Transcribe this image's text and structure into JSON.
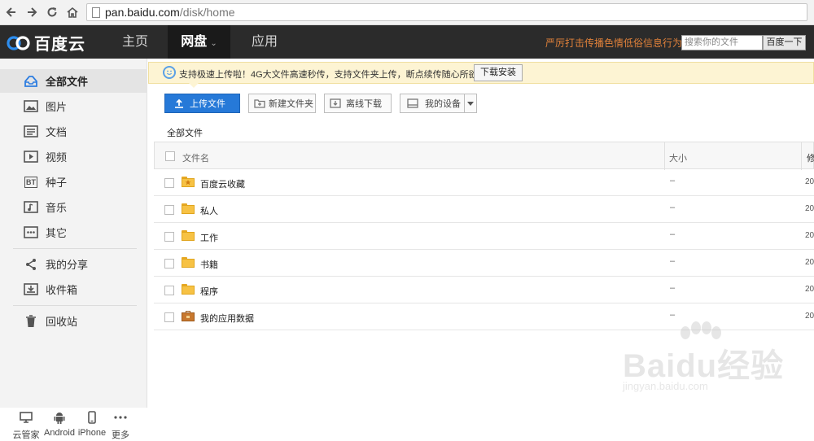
{
  "browser": {
    "url_host": "pan.baidu.com",
    "url_path": "/disk/home"
  },
  "topnav": {
    "logo": "百度云",
    "tabs": [
      {
        "label": "主页",
        "active": false
      },
      {
        "label": "网盘",
        "active": true
      },
      {
        "label": "应用",
        "active": false
      }
    ],
    "notice": "严厉打击传播色情低俗信息行为",
    "search_placeholder": "搜索你的文件",
    "search_button": "百度一下"
  },
  "sidebar": {
    "items": [
      {
        "label": "全部文件",
        "icon": "all-files-icon",
        "active": true
      },
      {
        "label": "图片",
        "icon": "image-icon"
      },
      {
        "label": "文档",
        "icon": "document-icon"
      },
      {
        "label": "视频",
        "icon": "video-icon"
      },
      {
        "label": "种子",
        "icon": "bt-icon",
        "glyph": "BT"
      },
      {
        "label": "音乐",
        "icon": "music-icon"
      },
      {
        "label": "其它",
        "icon": "more-icon"
      },
      {
        "label": "我的分享",
        "icon": "share-icon"
      },
      {
        "label": "收件箱",
        "icon": "inbox-icon"
      },
      {
        "label": "回收站",
        "icon": "trash-icon"
      }
    ],
    "devices": [
      {
        "label": "云管家",
        "icon": "monitor-icon"
      },
      {
        "label": "Android",
        "icon": "android-icon"
      },
      {
        "label": "iPhone",
        "icon": "phone-icon"
      },
      {
        "label": "更多",
        "icon": "ellipsis-icon"
      }
    ]
  },
  "tip": {
    "text": "支持极速上传啦！4G大文件高速秒传，支持文件夹上传，断点续传随心所欲！",
    "button": "下载安装"
  },
  "toolbar": {
    "upload": "上传文件",
    "new_folder": "新建文件夹",
    "offline_download": "离线下载",
    "my_devices": "我的设备"
  },
  "breadcrumb": "全部文件",
  "table": {
    "headers": {
      "name": "文件名",
      "size": "大小",
      "modified": "修"
    },
    "rows": [
      {
        "name": "百度云收藏",
        "size": "–",
        "date": "20"
      },
      {
        "name": "私人",
        "size": "–",
        "date": "20"
      },
      {
        "name": "工作",
        "size": "–",
        "date": "20"
      },
      {
        "name": "书籍",
        "size": "–",
        "date": "20"
      },
      {
        "name": "程序",
        "size": "–",
        "date": "20"
      },
      {
        "name": "我的应用数据",
        "size": "–",
        "date": "20"
      }
    ]
  },
  "watermark": {
    "brand": "Baidu经验",
    "url": "jingyan.baidu.com"
  },
  "colors": {
    "topnav_bg": "#2b2b2b",
    "accent_blue": "#2679d8",
    "notice_orange": "#e0813a",
    "tip_bg": "#fdf4d3",
    "folder_yellow": "#f7c244"
  }
}
